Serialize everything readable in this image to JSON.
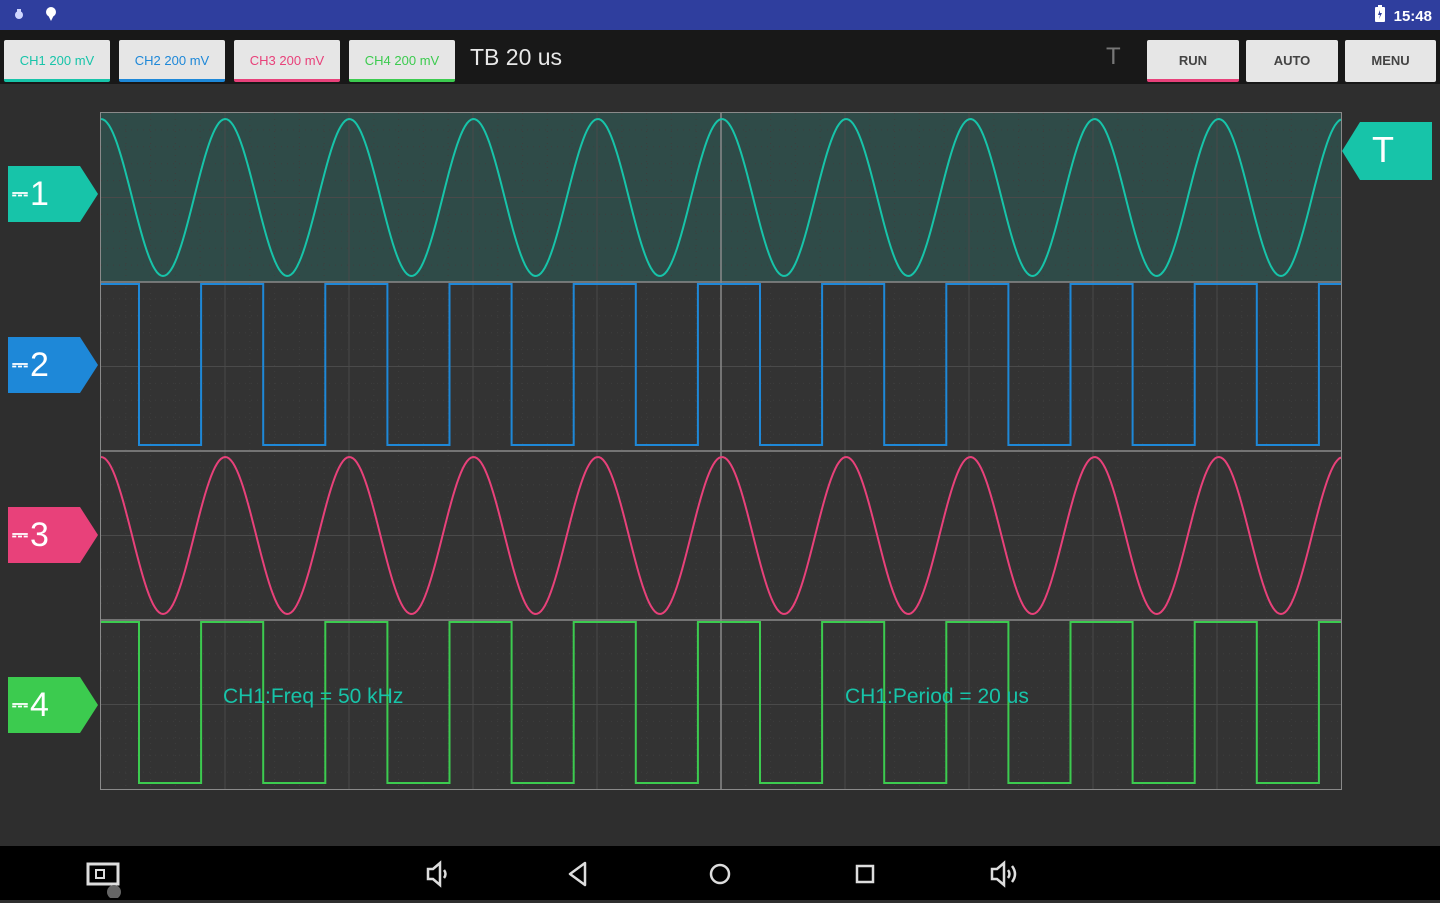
{
  "status": {
    "time": "15:48"
  },
  "toolbar": {
    "channels": [
      {
        "label": "CH1 200 mV",
        "color": "#17c4a9"
      },
      {
        "label": "CH2 200 mV",
        "color": "#1e88d8"
      },
      {
        "label": "CH3 200 mV",
        "color": "#e8417a"
      },
      {
        "label": "CH4 200 mV",
        "color": "#3ccb4f"
      }
    ],
    "timebase": "TB 20 us",
    "trigger_indicator": "T",
    "run_label": "RUN",
    "auto_label": "AUTO",
    "menu_label": "MENU",
    "run_accent": "#e8417a"
  },
  "markers": [
    {
      "num": "1",
      "color": "#17c4a9"
    },
    {
      "num": "2",
      "color": "#1e88d8"
    },
    {
      "num": "3",
      "color": "#e8417a"
    },
    {
      "num": "4",
      "color": "#3ccb4f"
    }
  ],
  "trigger_marker": {
    "label": "T",
    "color": "#17c4a9"
  },
  "measurements": {
    "freq": "CH1:Freq = 50 kHz",
    "period": "CH1:Period = 20 us"
  },
  "colors": {
    "screen_bg": "#333333",
    "ch1_fill": "#2f4b48",
    "grid": "#4a4a4a"
  }
}
